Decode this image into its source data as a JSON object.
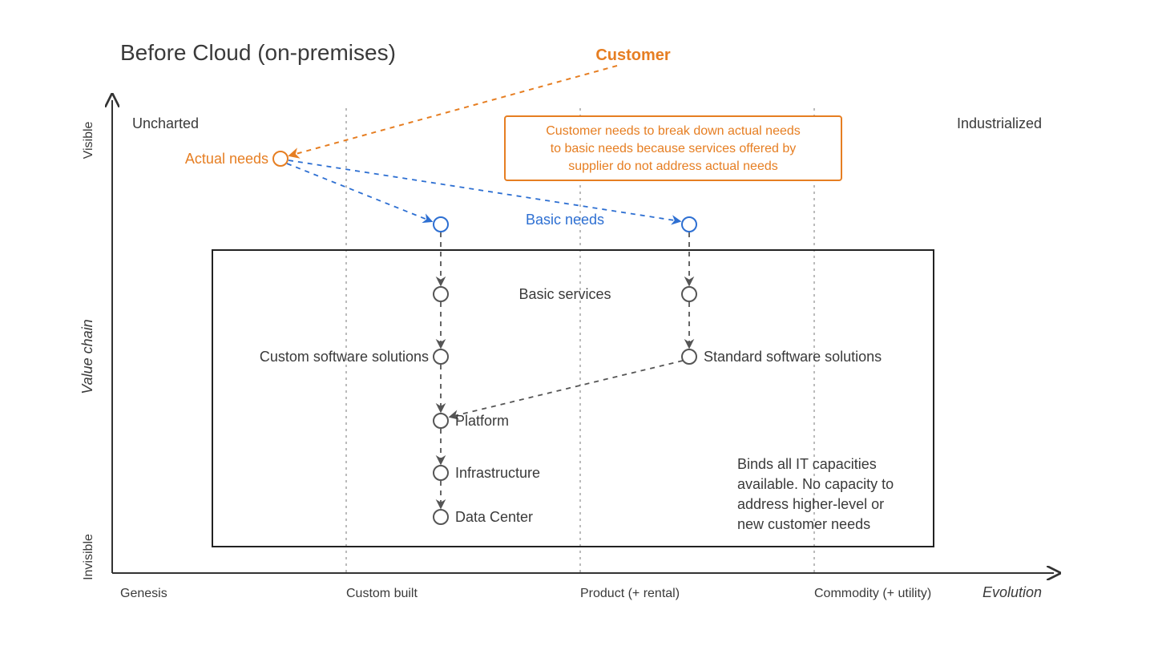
{
  "title": "Before Cloud (on-premises)",
  "axes": {
    "x": {
      "label": "Evolution",
      "ticks": [
        "Genesis",
        "Custom built",
        "Product (+ rental)",
        "Commodity (+ utility)"
      ]
    },
    "y": {
      "label": "Value chain",
      "top": "Visible",
      "bottom": "Invisible"
    }
  },
  "corners": {
    "nw": "Uncharted",
    "ne": "Industrialized"
  },
  "anchor": {
    "label": "Customer"
  },
  "annotation": {
    "line1": "Customer needs to break down actual needs",
    "line2": "to basic needs because services offered by",
    "line3": "supplier do not address actual needs"
  },
  "nodes": {
    "actual_needs": "Actual needs",
    "basic_needs": "Basic needs",
    "basic_services": "Basic services",
    "custom_sw": "Custom software solutions",
    "standard_sw": "Standard software solutions",
    "platform": "Platform",
    "infrastructure": "Infrastructure",
    "data_center": "Data Center"
  },
  "box_note": {
    "l1": "Binds all IT capacities",
    "l2": "available. No capacity to",
    "l3": "address higher-level or",
    "l4": "new customer needs"
  },
  "chart_data": {
    "type": "wardley-map",
    "x_axis": {
      "label": "Evolution",
      "stages": [
        "Genesis",
        "Custom built",
        "Product (+ rental)",
        "Commodity (+ utility)"
      ],
      "range": [
        0,
        1
      ]
    },
    "y_axis": {
      "label": "Value chain",
      "top": "Visible",
      "bottom": "Invisible",
      "range": [
        0,
        1
      ]
    },
    "title": "Before Cloud (on-premises)",
    "anchor": {
      "name": "Customer",
      "visibility": 1.05
    },
    "nodes": [
      {
        "id": "actual_needs",
        "label": "Actual needs",
        "evolution": 0.18,
        "visibility": 0.9,
        "color": "orange"
      },
      {
        "id": "basic_needs_l",
        "label": "Basic needs",
        "evolution": 0.38,
        "visibility": 0.76,
        "color": "blue"
      },
      {
        "id": "basic_needs_r",
        "label": "Basic needs",
        "evolution": 0.61,
        "visibility": 0.76,
        "color": "blue"
      },
      {
        "id": "basic_svc_l",
        "label": "Basic services",
        "evolution": 0.38,
        "visibility": 0.61
      },
      {
        "id": "basic_svc_r",
        "label": "Basic services",
        "evolution": 0.61,
        "visibility": 0.61
      },
      {
        "id": "custom_sw",
        "label": "Custom software solutions",
        "evolution": 0.38,
        "visibility": 0.48
      },
      {
        "id": "standard_sw",
        "label": "Standard software solutions",
        "evolution": 0.61,
        "visibility": 0.48
      },
      {
        "id": "platform",
        "label": "Platform",
        "evolution": 0.38,
        "visibility": 0.34
      },
      {
        "id": "infrastructure",
        "label": "Infrastructure",
        "evolution": 0.38,
        "visibility": 0.23
      },
      {
        "id": "data_center",
        "label": "Data Center",
        "evolution": 0.38,
        "visibility": 0.14
      }
    ],
    "edges": [
      {
        "from": "Customer",
        "to": "actual_needs",
        "style": "dashed",
        "color": "orange"
      },
      {
        "from": "actual_needs",
        "to": "basic_needs_l",
        "style": "dashed",
        "color": "blue"
      },
      {
        "from": "actual_needs",
        "to": "basic_needs_r",
        "style": "dashed",
        "color": "blue"
      },
      {
        "from": "basic_needs_l",
        "to": "basic_svc_l",
        "style": "dashed"
      },
      {
        "from": "basic_needs_r",
        "to": "basic_svc_r",
        "style": "dashed"
      },
      {
        "from": "basic_svc_l",
        "to": "custom_sw",
        "style": "dashed"
      },
      {
        "from": "basic_svc_r",
        "to": "standard_sw",
        "style": "dashed"
      },
      {
        "from": "custom_sw",
        "to": "platform",
        "style": "dashed"
      },
      {
        "from": "standard_sw",
        "to": "platform",
        "style": "dashed"
      },
      {
        "from": "platform",
        "to": "infrastructure",
        "style": "dashed"
      },
      {
        "from": "infrastructure",
        "to": "data_center",
        "style": "dashed"
      }
    ],
    "annotations": [
      {
        "text": "Customer needs to break down actual needs to basic needs because services offered by supplier do not address actual needs",
        "box": true,
        "color": "orange",
        "approx_pos": {
          "evolution": 0.58,
          "visibility": 0.9
        }
      },
      {
        "text": "Binds all IT capacities available. No capacity to address higher-level or new customer needs",
        "approx_pos": {
          "evolution": 0.72,
          "visibility": 0.2
        }
      }
    ],
    "supplier_box": {
      "evolution_range": [
        0.1,
        0.83
      ],
      "visibility_range": [
        0.05,
        0.7
      ]
    },
    "corners": {
      "nw": "Uncharted",
      "ne": "Industrialized"
    }
  }
}
